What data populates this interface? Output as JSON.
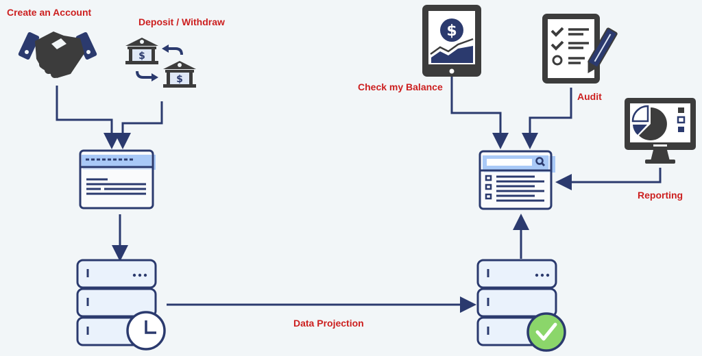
{
  "labels": {
    "create_account": "Create an Account",
    "deposit_withdraw": "Deposit / Withdraw",
    "check_balance": "Check my Balance",
    "audit": "Audit",
    "reporting": "Reporting",
    "data_projection": "Data Projection"
  },
  "colors": {
    "background": "#f2f6f8",
    "connector": "#2b3a6e",
    "label": "#cc1f1f",
    "icon_dark": "#3c3c3c",
    "accent_blue": "#a9c9f7",
    "check_green": "#8bd66a"
  },
  "nodes": [
    {
      "id": "create-account",
      "icon": "handshake-icon"
    },
    {
      "id": "deposit-withdraw",
      "icon": "bank-transfer-icon"
    },
    {
      "id": "command-form",
      "icon": "form-window-icon"
    },
    {
      "id": "event-store",
      "icon": "database-clock-icon"
    },
    {
      "id": "read-store",
      "icon": "database-check-icon"
    },
    {
      "id": "query-form",
      "icon": "search-window-icon"
    },
    {
      "id": "check-balance",
      "icon": "tablet-dollar-icon"
    },
    {
      "id": "audit",
      "icon": "checklist-pencil-icon"
    },
    {
      "id": "reporting",
      "icon": "monitor-pie-icon"
    }
  ]
}
